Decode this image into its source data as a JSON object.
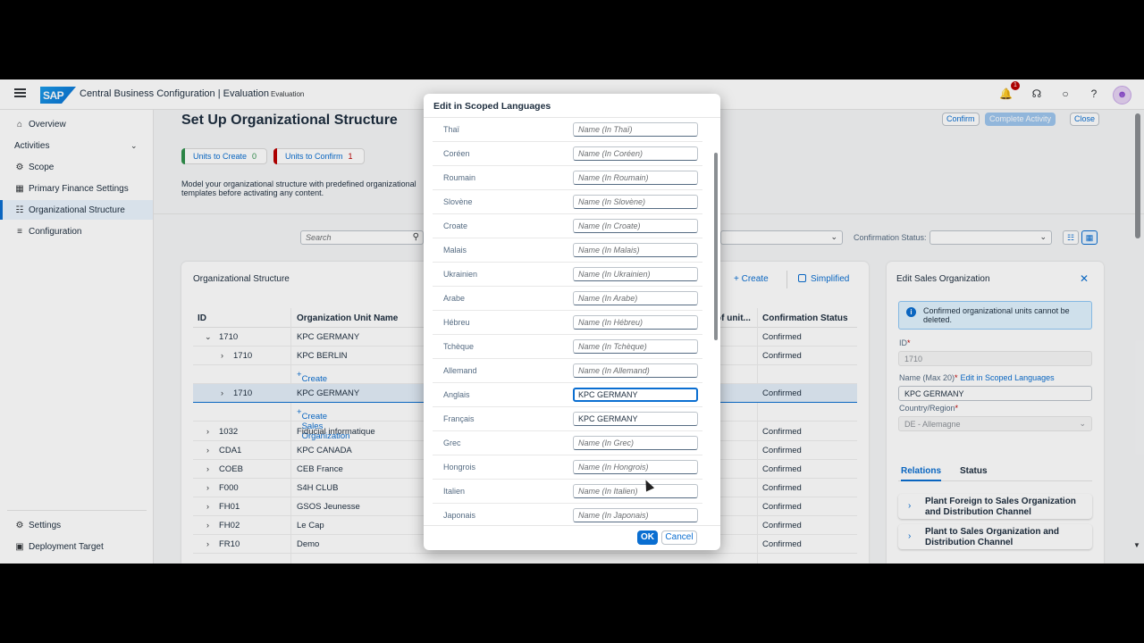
{
  "shell": {
    "title": "Central Business Configuration | Evaluation",
    "subtitle": "Evaluation",
    "logo_text": "SAP",
    "notification_count": "1",
    "icons": [
      "menu-icon",
      "bell-icon",
      "headset-icon",
      "chat-icon",
      "help-icon",
      "user-icon"
    ]
  },
  "sidenav": {
    "overview": "Overview",
    "activities": "Activities",
    "scope": "Scope",
    "primary_finance": "Primary Finance Settings",
    "org_structure": "Organizational Structure",
    "configuration": "Configuration",
    "settings": "Settings",
    "deployment": "Deployment Target"
  },
  "page": {
    "title": "Set Up Organizational Structure",
    "confirm": "Confirm",
    "complete": "Complete Activity",
    "close": "Close",
    "units_to_create_label": "Units to Create",
    "units_to_create_count": "0",
    "units_to_confirm_label": "Units to Confirm",
    "units_to_confirm_count": "1",
    "description": "Model your organizational structure with predefined organizational templates before activating any content.",
    "search_placeholder": "Search",
    "confirmation_status_label": "Confirmation Status:"
  },
  "org_table": {
    "title": "Organizational Structure",
    "create": "Create",
    "simplified": "Simplified",
    "columns": [
      "ID",
      "Organization Unit Name",
      "of unit...",
      "Confirmation Status"
    ],
    "rows": [
      {
        "id": "1710",
        "name": "KPC GERMANY",
        "status": "Confirmed"
      },
      {
        "id": "1710",
        "name": "KPC BERLIN",
        "status": "Confirmed"
      },
      {
        "id": "",
        "name": "Create Plant",
        "status": ""
      },
      {
        "id": "1710",
        "name": "KPC GERMANY",
        "status": "Confirmed"
      },
      {
        "id": "",
        "name": "Create Sales Organization",
        "status": ""
      },
      {
        "id": "1032",
        "name": "Fiducial informatique",
        "status": "Confirmed"
      },
      {
        "id": "CDA1",
        "name": "KPC CANADA",
        "status": "Confirmed"
      },
      {
        "id": "COEB",
        "name": "CEB France",
        "status": "Confirmed"
      },
      {
        "id": "F000",
        "name": "S4H CLUB",
        "status": "Confirmed"
      },
      {
        "id": "FH01",
        "name": "GSOS Jeunesse",
        "status": "Confirmed"
      },
      {
        "id": "FH02",
        "name": "Le Cap",
        "status": "Confirmed"
      },
      {
        "id": "FR10",
        "name": "Demo",
        "status": "Confirmed"
      }
    ]
  },
  "edit_panel": {
    "title": "Edit Sales Organization",
    "message": "Confirmed organizational units cannot be deleted.",
    "id_label": "ID",
    "id_value": "1710",
    "name_label": "Name (Max 20)",
    "edit_link": "Edit in Scoped Languages",
    "name_value": "KPC GERMANY",
    "country_label": "Country/Region",
    "country_value": "DE - Allemagne",
    "tab_relations": "Relations",
    "tab_status": "Status",
    "relations": [
      "Plant Foreign to Sales Organization and Distribution Channel",
      "Plant to Sales Organization and Distribution Channel"
    ]
  },
  "dialog": {
    "title": "Edit in Scoped Languages",
    "ok": "OK",
    "cancel": "Cancel",
    "languages": [
      {
        "name": "Thaï",
        "placeholder": "Name (In Thaï)",
        "value": ""
      },
      {
        "name": "Coréen",
        "placeholder": "Name (In Coréen)",
        "value": ""
      },
      {
        "name": "Roumain",
        "placeholder": "Name (In Roumain)",
        "value": ""
      },
      {
        "name": "Slovène",
        "placeholder": "Name (In Slovène)",
        "value": ""
      },
      {
        "name": "Croate",
        "placeholder": "Name (In Croate)",
        "value": ""
      },
      {
        "name": "Malais",
        "placeholder": "Name (In Malais)",
        "value": ""
      },
      {
        "name": "Ukrainien",
        "placeholder": "Name (In Ukrainien)",
        "value": ""
      },
      {
        "name": "Arabe",
        "placeholder": "Name (In Arabe)",
        "value": ""
      },
      {
        "name": "Hébreu",
        "placeholder": "Name (In Hébreu)",
        "value": ""
      },
      {
        "name": "Tchèque",
        "placeholder": "Name (In Tchèque)",
        "value": ""
      },
      {
        "name": "Allemand",
        "placeholder": "Name (In Allemand)",
        "value": ""
      },
      {
        "name": "Anglais",
        "placeholder": "",
        "value": "KPC GERMANY"
      },
      {
        "name": "Français",
        "placeholder": "",
        "value": "KPC GERMANY"
      },
      {
        "name": "Grec",
        "placeholder": "Name (In Grec)",
        "value": ""
      },
      {
        "name": "Hongrois",
        "placeholder": "Name (In Hongrois)",
        "value": ""
      },
      {
        "name": "Italien",
        "placeholder": "Name (In Italien)",
        "value": ""
      },
      {
        "name": "Japonais",
        "placeholder": "Name (In Japonais)",
        "value": ""
      }
    ]
  },
  "colors": {
    "brand": "#0a6ed1",
    "positive": "#30914c",
    "negative": "#bb0000"
  }
}
